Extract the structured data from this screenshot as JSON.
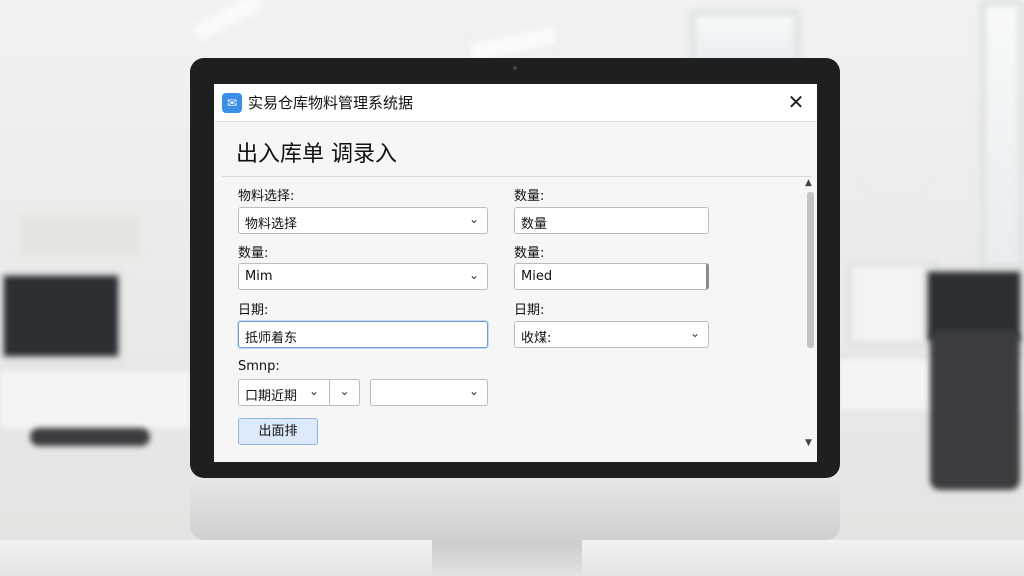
{
  "window": {
    "title": "实易仓库物料管理系统据",
    "close_glyph": "✕"
  },
  "form": {
    "heading": "出入库单 调录入",
    "fields": {
      "material_select": {
        "label": "物料选择:",
        "value": "物料选择"
      },
      "quantity_top": {
        "label": "数量:",
        "value": "数量"
      },
      "quantity_left": {
        "label": "数量:",
        "value": "Mim"
      },
      "quantity_right": {
        "label": "数量:",
        "value": "Mied"
      },
      "date_left": {
        "label": "日期:",
        "value": "抵师着东"
      },
      "date_right": {
        "label": "日期:",
        "value": "收煤:"
      },
      "smnp": {
        "label": "Smnp:",
        "value": "口期近期",
        "second_value": ""
      }
    },
    "submit_label": "出面排"
  },
  "icons": {
    "app": "app-logo-icon",
    "chevron": "chevron-down-icon",
    "close": "close-icon"
  },
  "colors": {
    "accent": "#3a8ee6",
    "focus_border": "#6d9ed6",
    "button_bg": "#dce9f8"
  }
}
